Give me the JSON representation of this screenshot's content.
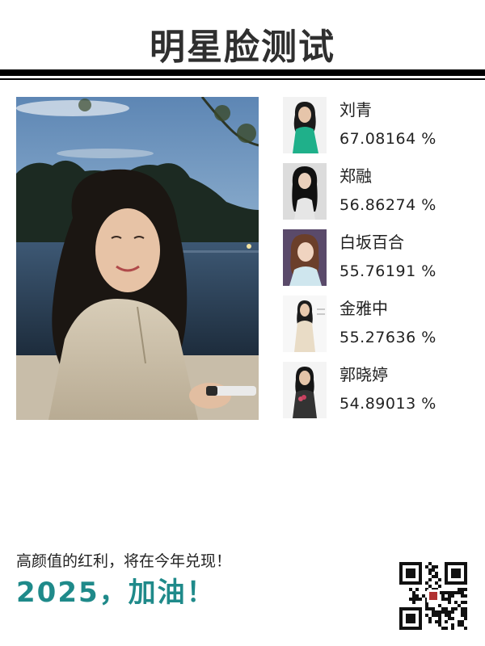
{
  "header": {
    "title": "明星脸测试"
  },
  "photo": {
    "icon": "portrait-photo"
  },
  "results": [
    {
      "name": "刘青",
      "score": "67.08164 %",
      "dress": "#1fb08a",
      "icon": "celebrity-portrait"
    },
    {
      "name": "郑融",
      "score": "56.86274 %",
      "dress": "#e6e6e6",
      "icon": "celebrity-portrait"
    },
    {
      "name": "白坂百合",
      "score": "55.76191 %",
      "dress": "#cfe6ee",
      "icon": "celebrity-portrait"
    },
    {
      "name": "金雅中",
      "score": "55.27636 %",
      "dress": "#e9dcc6",
      "icon": "celebrity-portrait"
    },
    {
      "name": "郭晓婷",
      "score": "54.89013 %",
      "dress": "#333333",
      "icon": "celebrity-portrait"
    }
  ],
  "footer": {
    "slogan": "高颜值的红利，将在今年兑现！",
    "cheer": "2025，加油！",
    "accent_color": "#1f8a8a",
    "qr_icon": "qr-code"
  }
}
